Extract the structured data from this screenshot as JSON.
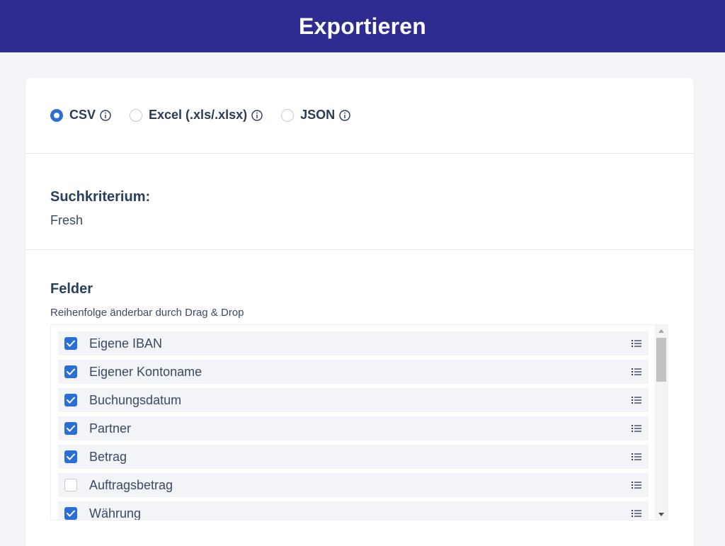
{
  "header": {
    "title": "Exportieren"
  },
  "format": {
    "options": [
      {
        "label": "CSV",
        "checked": true
      },
      {
        "label": "Excel (.xls/.xlsx)",
        "checked": false
      },
      {
        "label": "JSON",
        "checked": false
      }
    ]
  },
  "criteria": {
    "title": "Suchkriterium:",
    "value": "Fresh"
  },
  "fields": {
    "title": "Felder",
    "hint": "Reihenfolge änderbar durch Drag & Drop",
    "items": [
      {
        "label": "Eigene IBAN",
        "checked": true
      },
      {
        "label": "Eigener Kontoname",
        "checked": true
      },
      {
        "label": "Buchungsdatum",
        "checked": true
      },
      {
        "label": "Partner",
        "checked": true
      },
      {
        "label": "Betrag",
        "checked": true
      },
      {
        "label": "Auftragsbetrag",
        "checked": false
      },
      {
        "label": "Währung",
        "checked": true
      }
    ]
  },
  "colors": {
    "header": "#2e2b91",
    "accent": "#2a6fd8"
  },
  "icons": {
    "info": "info-circle-icon",
    "drag": "drag-handle-icon",
    "check": "checkmark-icon"
  }
}
